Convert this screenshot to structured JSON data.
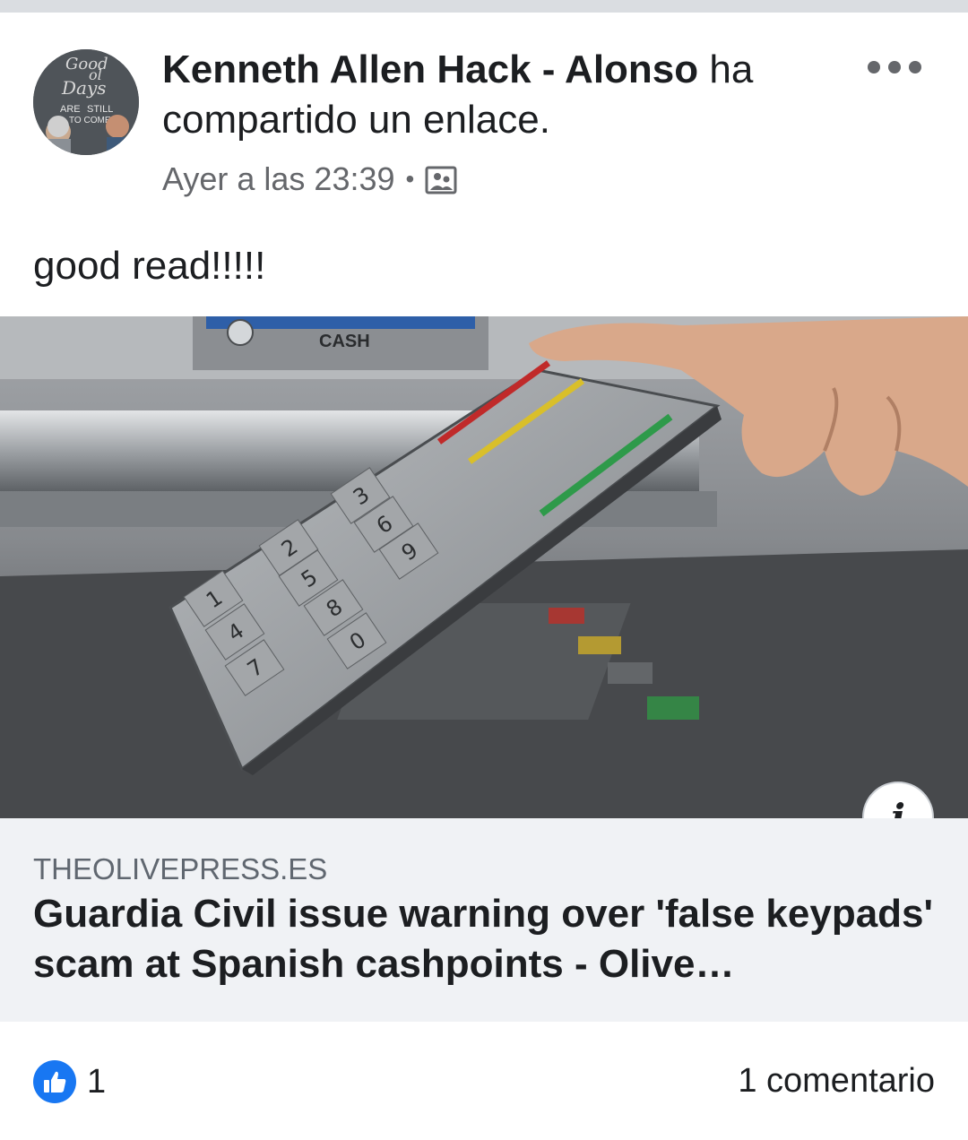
{
  "post": {
    "author": "Kenneth Allen Hack - Alonso",
    "action": " ha compartido un enlace.",
    "timestamp": "Ayer a las 23:39",
    "separator": "•",
    "privacy_icon": "photo-album-icon",
    "more_icon": "more-options-icon",
    "text": "good read!!!!!"
  },
  "avatar": {
    "lines": [
      "Good",
      "ol",
      "Days",
      "ARE",
      "STILL",
      "TO COME"
    ]
  },
  "link": {
    "image_labels": {
      "cash": "CASH",
      "keys": [
        "1",
        "2",
        "3",
        "4",
        "5",
        "6",
        "7",
        "8",
        "9",
        "0"
      ]
    },
    "info_label": "i",
    "domain": "THEOLIVEPRESS.ES",
    "title": "Guardia Civil issue warning over 'false keypads' scam at Spanish cashpoints - Olive…"
  },
  "footer": {
    "like_icon": "thumbs-up-icon",
    "like_count": "1",
    "comments": "1 comentario"
  },
  "colors": {
    "accent": "#1877f2",
    "secondary_text": "#65676b",
    "link_background": "#f0f2f5"
  }
}
